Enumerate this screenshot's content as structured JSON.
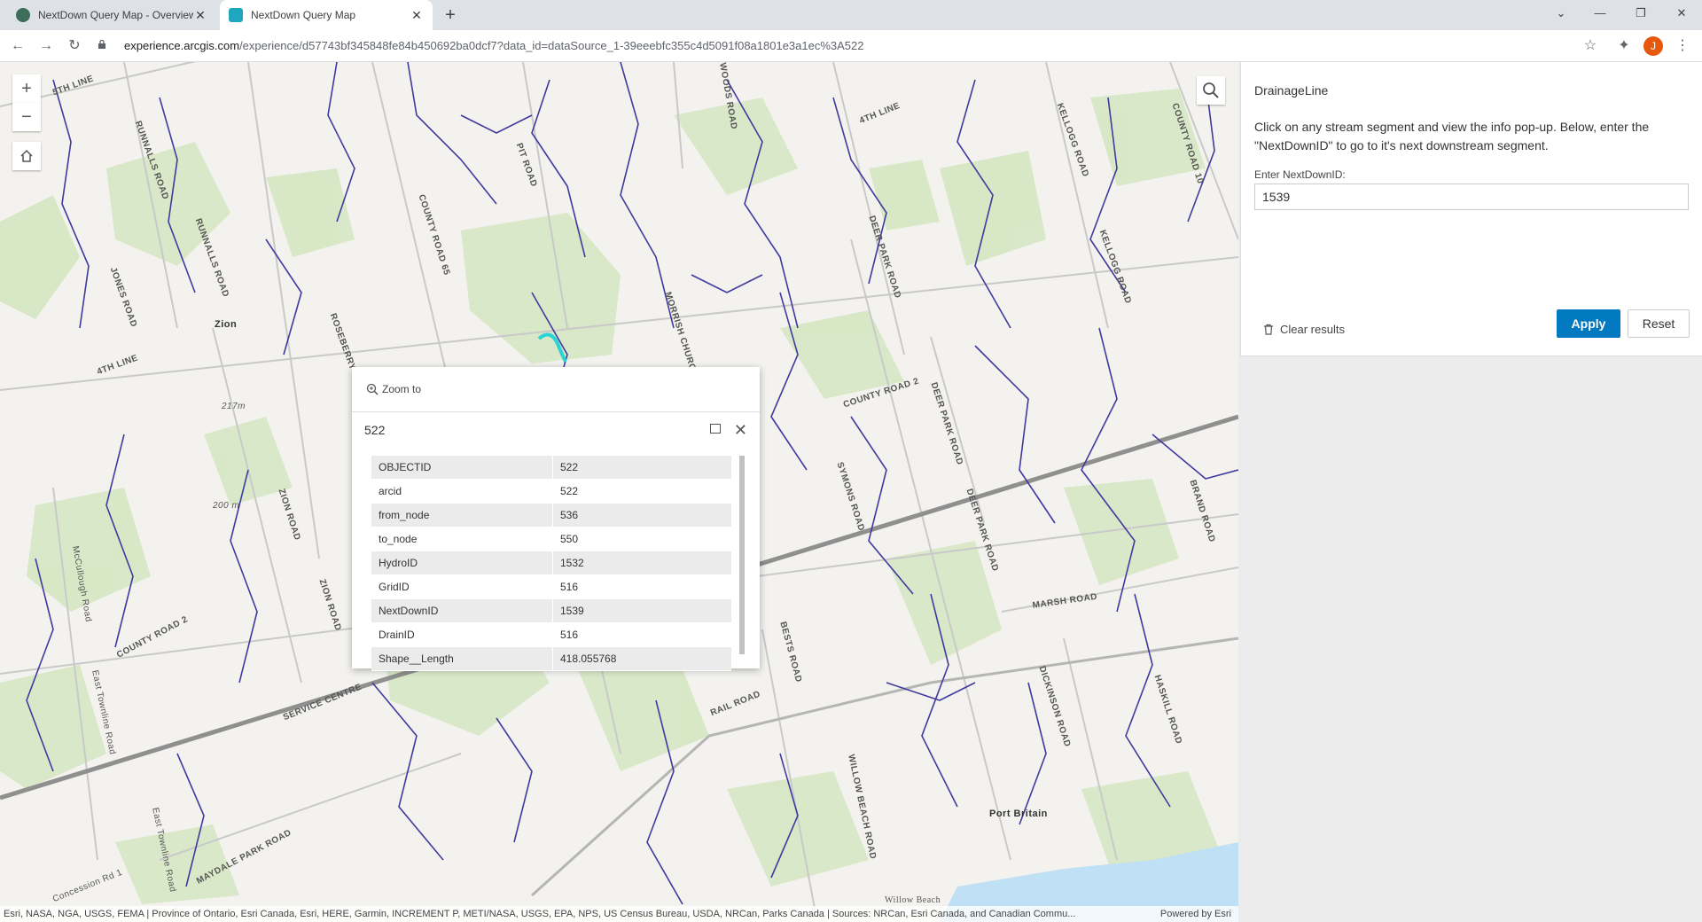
{
  "browser": {
    "tabs": [
      {
        "label": "NextDown Query Map - Overview",
        "active": false
      },
      {
        "label": "NextDown Query Map",
        "active": true
      }
    ],
    "new_tab": "+",
    "url_domain": "experience.arcgis.com",
    "url_path": "/experience/d57743bf345848fe84b450692ba0dcf7?data_id=dataSource_1-39eeebfc355c4d5091f08a1801e3a1ec%3A522",
    "profile_initial": "J"
  },
  "map": {
    "labels": [
      "5TH LINE",
      "RUNNALLS ROAD",
      "RUNNALLS ROAD",
      "COUNTY ROAD 65",
      "PIT ROAD",
      "WOODS ROAD",
      "4TH LINE",
      "KELLOGG ROAD",
      "KELLOGG ROAD",
      "COUNTY ROAD 10",
      "DEER PARK ROAD",
      "JONES ROAD",
      "Zion",
      "ROSEBERRY R",
      "4TH LINE",
      "217m",
      "MORRISH CHURCH",
      "COUNTY ROAD 2",
      "DEER PARK ROAD",
      "SYMONS ROAD",
      "DEER PARK ROAD",
      "BRAND ROAD",
      "ZION ROAD",
      "ZION ROAD",
      "McCullough Road",
      "COUNTY ROAD 2",
      "East Townline Road",
      "SERVICE CENTRE",
      "BESTS ROAD",
      "RAIL ROAD",
      "MARSH ROAD",
      "DICKINSON ROAD",
      "HASKILL ROAD",
      "WILLOW BEACH ROAD",
      "Port Britain",
      "East Townline Road",
      "MAYDALE PARK ROAD",
      "Concession Rd 1",
      "Willow Beach",
      "200 m"
    ],
    "attribution": "Esri, NASA, NGA, USGS, FEMA | Province of Ontario, Esri Canada, Esri, HERE, Garmin, INCREMENT P, METI/NASA, USGS, EPA, NPS, US Census Bureau, USDA, NRCan, Parks Canada | Sources: NRCan, Esri Canada, and Canadian Commu...",
    "powered_by": "Powered by Esri"
  },
  "popup": {
    "zoom_to": "Zoom to",
    "title": "522",
    "rows": [
      {
        "key": "OBJECTID",
        "value": "522"
      },
      {
        "key": "arcid",
        "value": "522"
      },
      {
        "key": "from_node",
        "value": "536"
      },
      {
        "key": "to_node",
        "value": "550"
      },
      {
        "key": "HydroID",
        "value": "1532"
      },
      {
        "key": "GridID",
        "value": "516"
      },
      {
        "key": "NextDownID",
        "value": "1539"
      },
      {
        "key": "DrainID",
        "value": "516"
      },
      {
        "key": "Shape__Length",
        "value": "418.055768"
      }
    ]
  },
  "panel": {
    "title": "DrainageLine",
    "description": "Click on any stream segment and view the info pop-up. Below, enter the \"NextDownID\" to go to it's next downstream segment.",
    "input_label": "Enter NextDownID:",
    "input_value": "1539",
    "clear_results": "Clear results",
    "apply": "Apply",
    "reset": "Reset"
  },
  "colors": {
    "accent": "#0079c1",
    "stream": "#3f3a9e",
    "selected": "#2ad4d4",
    "vegetation": "#d3e5c1"
  }
}
